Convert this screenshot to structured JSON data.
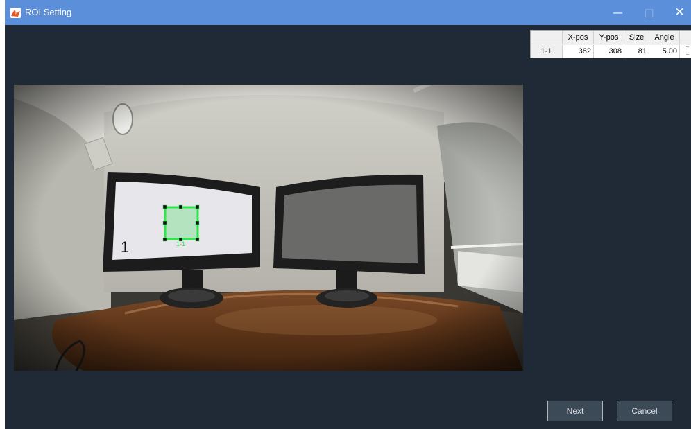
{
  "window": {
    "title": "ROI Setting",
    "minimize_label": "—",
    "maximize_label": "□",
    "close_label": "✕",
    "app_icon": "matlab-icon"
  },
  "roi_table": {
    "columns": [
      "X-pos",
      "Y-pos",
      "Size",
      "Angle"
    ],
    "rows": [
      {
        "id": "1-1",
        "x_pos": "382",
        "y_pos": "308",
        "size": "81",
        "angle": "5.00"
      }
    ],
    "spinner": {
      "up": "⌃",
      "down": "⌄"
    }
  },
  "image": {
    "monitor_label": "1",
    "roi_label": "1-1",
    "roi_color": "#2ee84a"
  },
  "buttons": {
    "next_label": "Next",
    "cancel_label": "Cancel"
  },
  "colors": {
    "titlebar": "#5c8fd9",
    "background": "#1f2a36"
  }
}
